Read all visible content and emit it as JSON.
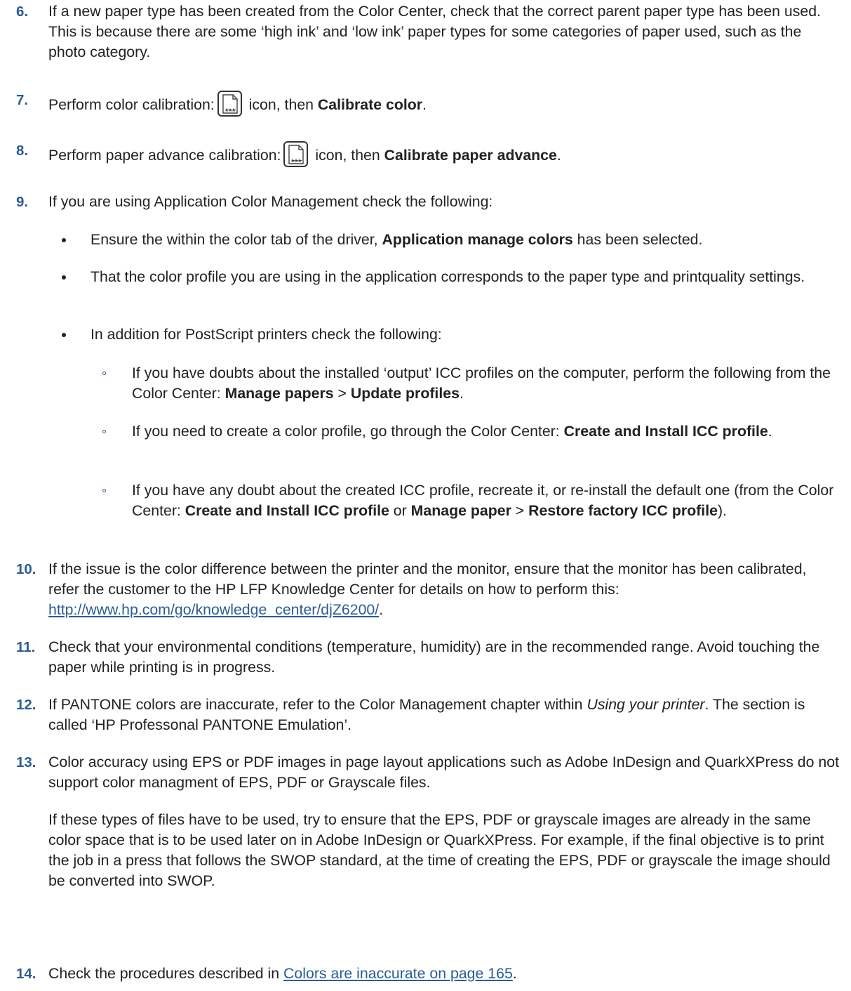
{
  "steps": {
    "s6": {
      "num": "6.",
      "text": "If a new paper type has been created from the Color Center, check that the correct parent paper type has been used. This is because there are some ‘high ink’ and ‘low ink’ paper types for some categories of paper used, such as the photo category."
    },
    "s7": {
      "num": "7.",
      "pre": "Perform color calibration:",
      "post": " icon, then ",
      "bold": "Calibrate color",
      "end": "."
    },
    "s8": {
      "num": "8.",
      "pre": "Perform paper advance calibration:",
      "post": " icon, then ",
      "bold": "Calibrate paper advance",
      "end": "."
    },
    "s9": {
      "num": "9.",
      "text": "If you are using Application Color Management check the following:",
      "b1": {
        "pre": "Ensure the within the color tab of the driver, ",
        "bold": "Application manage colors",
        "post": " has been selected."
      },
      "b2": {
        "text": "That the color profile you are using in the application corresponds to the paper type and printquality settings."
      },
      "b3": {
        "text": "In addition for PostScript printers check the following:"
      },
      "c1": {
        "pre": "If you have doubts about the installed ‘output’ ICC profiles on the computer, perform the following from the Color Center: ",
        "bold1": "Manage papers",
        "sep": " > ",
        "bold2": "Update profiles",
        "end": "."
      },
      "c2": {
        "pre": "If you need to create a color profile, go through the Color Center: ",
        "bold": "Create and Install ICC profile",
        "end": "."
      },
      "c3": {
        "pre": "If you have any doubt about the created ICC profile, recreate it, or re-install the default one (from the Color Center: ",
        "bold1": "Create and Install ICC profile",
        "or": " or ",
        "bold2": "Manage paper",
        "sep": " > ",
        "bold3": "Restore factory ICC profile",
        "end": ")."
      }
    },
    "s10": {
      "num": "10.",
      "pre": "If the issue is the color difference between the printer and the monitor, ensure that the monitor has been calibrated, refer the customer to the HP LFP Knowledge Center for details on how to perform this: ",
      "link": "http://www.hp.com/go/knowledge_center/djZ6200/",
      "end": "."
    },
    "s11": {
      "num": "11.",
      "text": "Check that your environmental conditions (temperature, humidity) are in the recommended range. Avoid touching the paper while printing is in progress."
    },
    "s12": {
      "num": "12.",
      "pre": "If PANTONE colors are inaccurate, refer to the Color Management chapter within ",
      "italic": "Using your printer",
      "post": ". The section is called ‘HP Professonal PANTONE Emulation’."
    },
    "s13": {
      "num": "13.",
      "text": "Color accuracy using EPS or PDF images in page layout applications such as Adobe InDesign and QuarkXPress do not support color managment of EPS, PDF or Grayscale files.",
      "para2": "If these types of files have to be used, try to ensure that the EPS, PDF or grayscale images are already in the same color space that is to be used later on in Adobe InDesign or QuarkXPress. For example, if the final objective is to print the job in a press that follows the SWOP standard, at the time of creating the EPS, PDF or grayscale the image should be converted into SWOP."
    },
    "s14": {
      "num": "14.",
      "pre": "Check the procedures described in ",
      "link": "Colors are inaccurate on page 165",
      "end": "."
    }
  },
  "colors": {
    "accent": "#2b5d91",
    "text": "#222222"
  },
  "icons": {
    "calibration": "paper-stars-icon"
  }
}
